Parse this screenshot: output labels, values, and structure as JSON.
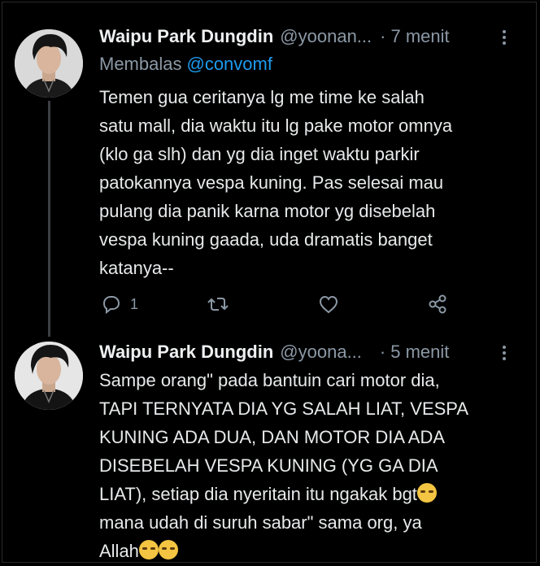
{
  "tweets": [
    {
      "author": "Waipu Park Dungdin",
      "handle": "@yoonan...",
      "dot": "·",
      "time": "7 menit",
      "reply_prefix": "Membalas",
      "reply_mention": "@convomf",
      "text": "Temen gua ceritanya lg me time ke salah\nsatu mall, dia waktu itu lg pake motor omnya\n(klo ga slh) dan yg dia inget waktu parkir\npatokannya vespa kuning. Pas selesai mau\npulang dia panik karna motor yg disebelah\nvespa kuning gaada, uda dramatis banget\nkatanya--",
      "reply_count": "1",
      "icons": [
        "reply-icon",
        "retweet-icon",
        "like-icon",
        "share-icon",
        "more-icon"
      ]
    },
    {
      "author": "Waipu Park Dungdin",
      "handle": "@yoona...",
      "dot": "·",
      "time": "5 menit",
      "text_lines": [
        "Sampe orang\" pada bantuin cari motor dia,",
        "TAPI TERNYATA DIA YG SALAH LIAT, VESPA",
        "KUNING ADA DUA, DAN MOTOR DIA ADA",
        "DISEBELAH VESPA KUNING (YG GA DIA",
        "LIAT), setiap dia nyeritain itu ngakak bgt",
        "mana udah di suruh sabar\" sama org, ya",
        "Allah"
      ],
      "emoji": "😭",
      "icons": [
        "more-icon"
      ]
    }
  ],
  "colors": {
    "background": "#000000",
    "text": "#e7e9ea",
    "muted": "#8b98a5",
    "mention": "#1d9bf0",
    "thread_line": "#3b3f44"
  }
}
